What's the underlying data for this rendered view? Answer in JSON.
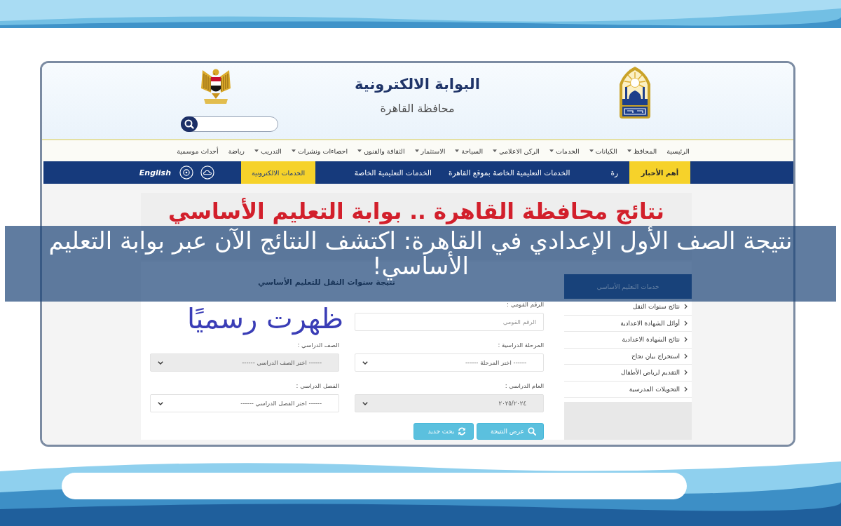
{
  "caption": "نتيجة الصف الأول الإعدادي في القاهرة: اكتشف النتائج الآن عبر بوابة التعليم الأساسي!",
  "stamp": "ظهرت رسميًا",
  "portal": {
    "header": {
      "title": "البوابة الالكترونية",
      "subtitle": "محافظة القاهرة"
    },
    "menu": [
      {
        "label": "الرئيسية",
        "has_dropdown": false
      },
      {
        "label": "المحافظ",
        "has_dropdown": true
      },
      {
        "label": "الكيانات",
        "has_dropdown": true
      },
      {
        "label": "الخدمات",
        "has_dropdown": true
      },
      {
        "label": "الركن الاعلامي",
        "has_dropdown": true
      },
      {
        "label": "السياحة",
        "has_dropdown": true
      },
      {
        "label": "الاستثمار",
        "has_dropdown": true
      },
      {
        "label": "الثقافة والفنون",
        "has_dropdown": true
      },
      {
        "label": "احصاءات ونشرات",
        "has_dropdown": true
      },
      {
        "label": "التدريب",
        "has_dropdown": true
      },
      {
        "label": "رياضة",
        "has_dropdown": false
      },
      {
        "label": "أحداث موسمية",
        "has_dropdown": false
      }
    ],
    "news_bar": {
      "label": "أهم الأخبار",
      "ticker": [
        "رة",
        "الخدمات التعليمية الخاصة بموقع القاهرة",
        "الخدمات التعليمية الخاصة"
      ],
      "services_tab": "الخدمات الالكترونية",
      "language": "English"
    },
    "banner": {
      "title": "نتائج محافظة القاهرة .. بوابة التعليم الأساسي"
    },
    "form": {
      "heading": "نتيجة سنوات النقل للتعليم الأساسي",
      "rows": [
        {
          "fields": [
            {
              "label": "الرقم القومي :",
              "kind": "input",
              "placeholder": "الرقم القومي",
              "disabled": false
            }
          ]
        },
        {
          "fields": [
            {
              "label": "المرحلة الدراسية :",
              "kind": "select",
              "value": "------ اختر المرحلة ------",
              "disabled": false
            },
            {
              "label": "الصف الدراسي :",
              "kind": "select",
              "value": "------ اختر الصف الدراسي ------",
              "disabled": true
            }
          ]
        },
        {
          "fields": [
            {
              "label": "العام الدراسي :",
              "kind": "select",
              "value": "٢٠٢٥/٢٠٢٤",
              "disabled": true
            },
            {
              "label": "الفصل الدراسي :",
              "kind": "select",
              "value": "------ اختر الفصل الدراسي ------",
              "disabled": false
            }
          ]
        }
      ],
      "buttons": [
        {
          "label": "عرض النتيجة",
          "kind": "search"
        },
        {
          "label": "بحث جديد",
          "kind": "refresh"
        }
      ]
    },
    "sidebar": {
      "header": "خدمات التعليم الأساسي",
      "items": [
        "نتائج سنوات النقل",
        "أوائل الشهادة الاعدادية",
        "نتائج الشهادة الاعدادية",
        "استخراج بيان نجاح",
        "التقديم لرياض الأطفال",
        "التحويلات المدرسية"
      ]
    }
  }
}
